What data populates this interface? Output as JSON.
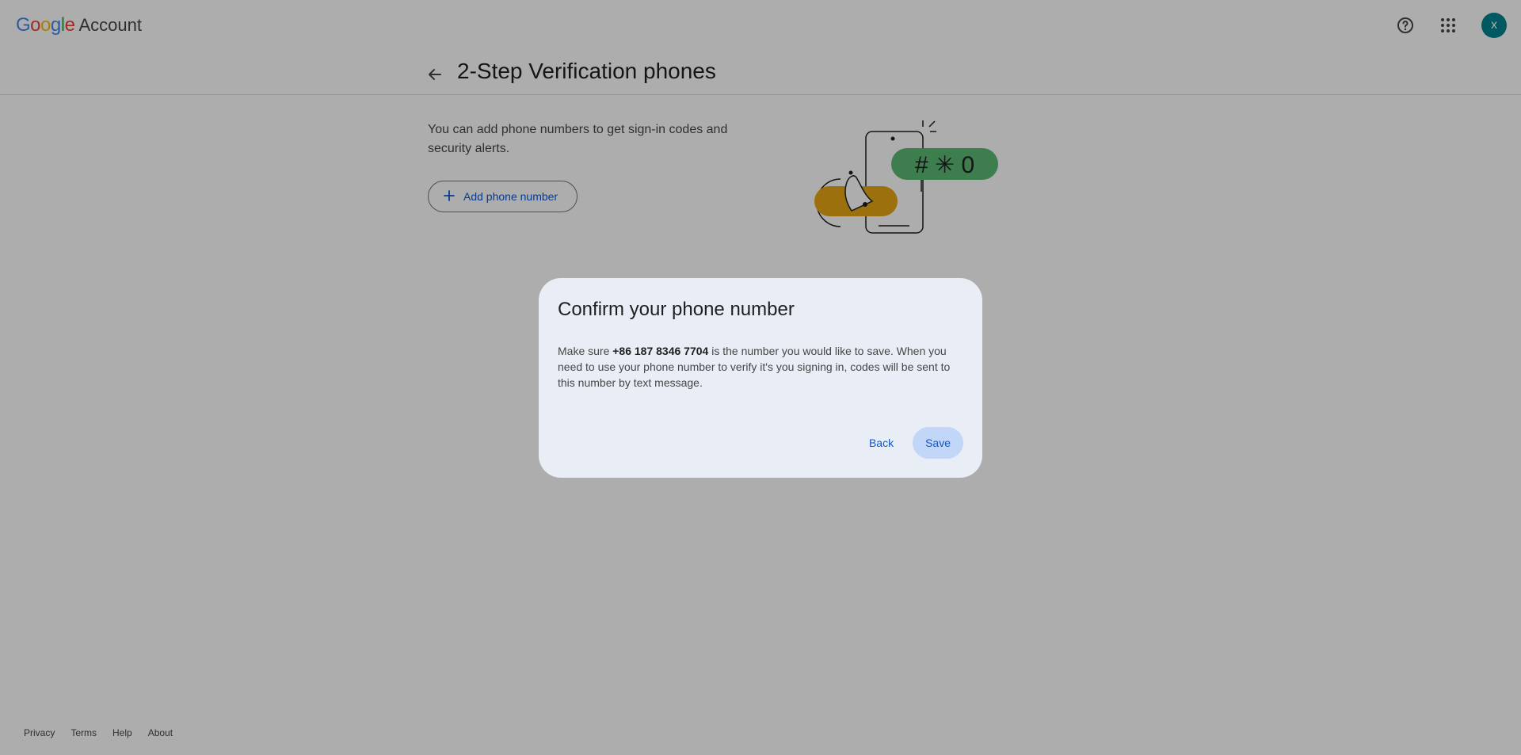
{
  "header": {
    "logo_letters": [
      "G",
      "o",
      "o",
      "g",
      "l",
      "e"
    ],
    "logo_colors": [
      "#4285f4",
      "#ea4335",
      "#fbbc05",
      "#4285f4",
      "#34a853",
      "#ea4335"
    ],
    "account_label": "Account",
    "help_icon": "help-circle-icon",
    "apps_icon": "apps-grid-icon",
    "avatar_initial": "x",
    "avatar_color": "#00838f"
  },
  "titlebar": {
    "back_icon": "arrow-back-icon",
    "title": "2-Step Verification phones"
  },
  "main": {
    "intro_text": "You can add phone numbers to get sign-in codes and security alerts.",
    "add_button_label": "Add phone number",
    "add_icon": "plus-icon",
    "illustration_icon": "phone-notification-illustration",
    "illustration_code": "# ✳ 0"
  },
  "dialog": {
    "title": "Confirm your phone number",
    "body_prefix": "Make sure ",
    "phone_number": "+86 187 8346 7704",
    "body_suffix": " is the number you would like to save. When you need to use your phone number to verify it's you signing in, codes will be sent to this number by text message.",
    "back_label": "Back",
    "save_label": "Save"
  },
  "footer": {
    "links": [
      "Privacy",
      "Terms",
      "Help",
      "About"
    ]
  }
}
